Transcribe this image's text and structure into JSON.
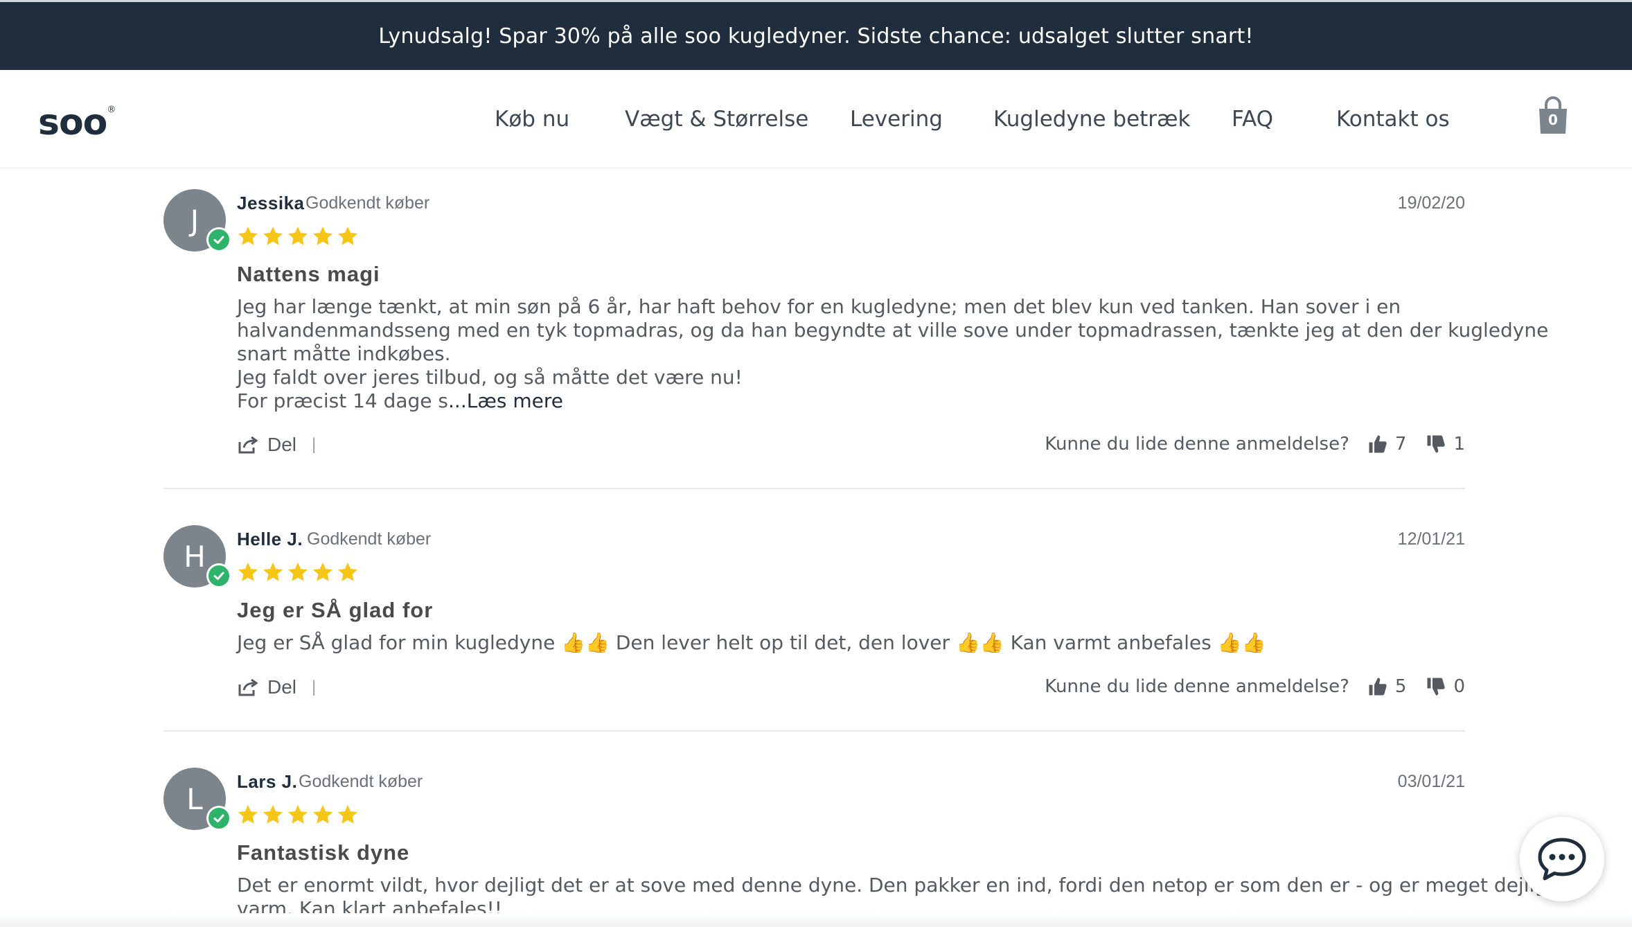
{
  "promo": {
    "text": "Lynudsalg! Spar 30% på alle soo kugledyner. Sidste chance: udsalget slutter snart!"
  },
  "header": {
    "logo": "soo",
    "logo_mark": "®",
    "nav": [
      "Køb nu",
      "Vægt & Størrelse",
      "Levering",
      "Kugledyne betræk",
      "FAQ",
      "Kontakt os"
    ],
    "cart_count": "0",
    "cart_icon": "shopping-bag-icon"
  },
  "reviews": [
    {
      "initial": "J",
      "name": "Jessika",
      "verified": "Godkendt køber",
      "date": "19/02/20",
      "rating": 5,
      "title": "Nattens magi",
      "lines": [
        "Jeg har længe tænkt, at min søn på 6 år, har haft behov for en kugledyne; men det blev kun ved tanken. Han sover i en",
        "halvandenmandsseng med en tyk topmadras, og da han begyndte at ville sove under topmadrassen, tænkte jeg at den der kugledyne",
        "snart måtte indkøbes.",
        "Jeg faldt over jeres tilbud, og så måtte det være nu!",
        "For præcist 14 dage s"
      ],
      "read_more": "...Læs mere",
      "share": "Del",
      "separator": "|",
      "helpful_question": "Kunne du lide denne anmeldelse?",
      "upvotes": "7",
      "downvotes": "1"
    },
    {
      "initial": "H",
      "name": "Helle J.",
      "verified": "Godkendt køber",
      "date": "12/01/21",
      "rating": 5,
      "title": "Jeg er SÅ glad for",
      "segments": [
        "Jeg er SÅ glad for min kugledyne",
        "Den lever helt op til det, den lover",
        "Kan varmt anbefales"
      ],
      "emoji": "👍👍",
      "share": "Del",
      "separator": "|",
      "helpful_question": "Kunne du lide denne anmeldelse?",
      "upvotes": "5",
      "downvotes": "0"
    },
    {
      "initial": "L",
      "name": "Lars J.",
      "verified": "Godkendt køber",
      "date": "03/01/21",
      "rating": 5,
      "title": "Fantastisk dyne",
      "lines": [
        "Det er enormt vildt, hvor dejligt det er at sove med denne dyne. Den pakker en ind, fordi den netop er som den er - og er meget dejlig",
        "varm. Kan klart anbefales!!"
      ]
    }
  ],
  "colors": {
    "promo_bg": "#1f2d3d",
    "star": "#f5c518",
    "verified_badge": "#2fb36a",
    "avatar": "#7c848c"
  },
  "chat": {
    "icon": "chat-bubble-icon"
  }
}
